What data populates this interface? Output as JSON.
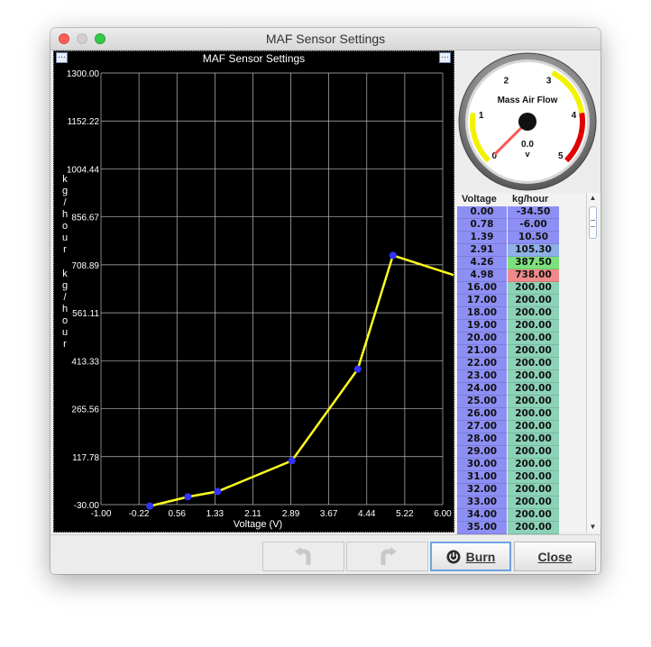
{
  "window": {
    "title": "MAF Sensor Settings"
  },
  "chart": {
    "title": "MAF Sensor Settings",
    "menu_glyph": "...",
    "xlabel": "Voltage (V)",
    "ylabel_chars": [
      "k",
      "g",
      "/",
      "h",
      "o",
      "u",
      "r"
    ],
    "y_ticks": [
      "1300.00",
      "1152.22",
      "1004.44",
      "856.67",
      "708.89",
      "561.11",
      "413.33",
      "265.56",
      "117.78",
      "-30.00"
    ],
    "x_ticks": [
      "-1.00",
      "-0.22",
      "0.56",
      "1.33",
      "2.11",
      "2.89",
      "3.67",
      "4.44",
      "5.22",
      "6.00"
    ]
  },
  "chart_data": {
    "type": "line",
    "title": "MAF Sensor Settings",
    "xlabel": "Voltage (V)",
    "ylabel": "kg/hour",
    "xlim": [
      -1.0,
      6.0
    ],
    "ylim": [
      -30.0,
      1300.0
    ],
    "grid": true,
    "x": [
      0.0,
      0.78,
      1.39,
      2.91,
      4.26,
      4.98,
      16.0
    ],
    "y": [
      -34.5,
      -6.0,
      10.5,
      105.3,
      387.5,
      738.0,
      200.0
    ],
    "line_color": "#ffff22",
    "point_color": "#3333ff"
  },
  "gauge": {
    "title": "Mass Air Flow",
    "value": "0.0",
    "units": "v",
    "labels": [
      "0",
      "1",
      "2",
      "3",
      "4",
      "5"
    ],
    "min": 0,
    "max": 5,
    "warn_low": [
      0,
      1
    ],
    "warn_high": [
      3,
      4
    ],
    "danger_high": [
      4,
      5
    ],
    "colors": {
      "warn": "#f3f300",
      "danger": "#e10000",
      "needle": "#ff5555"
    }
  },
  "table": {
    "headers": [
      "Voltage",
      "kg/hour"
    ],
    "rows": [
      [
        "0.00",
        "-34.50",
        "#8d8ff5"
      ],
      [
        "0.78",
        "-6.00",
        "#8d8ff5"
      ],
      [
        "1.39",
        "10.50",
        "#8d8ff5"
      ],
      [
        "2.91",
        "105.30",
        "#8fb0e8"
      ],
      [
        "4.26",
        "387.50",
        "#7de07d"
      ],
      [
        "4.98",
        "738.00",
        "#f08a8a"
      ],
      [
        "16.00",
        "200.00",
        "#8cd2b8"
      ],
      [
        "17.00",
        "200.00",
        "#8cd2b8"
      ],
      [
        "18.00",
        "200.00",
        "#8cd2b8"
      ],
      [
        "19.00",
        "200.00",
        "#8cd2b8"
      ],
      [
        "20.00",
        "200.00",
        "#8cd2b8"
      ],
      [
        "21.00",
        "200.00",
        "#8cd2b8"
      ],
      [
        "22.00",
        "200.00",
        "#8cd2b8"
      ],
      [
        "23.00",
        "200.00",
        "#8cd2b8"
      ],
      [
        "24.00",
        "200.00",
        "#8cd2b8"
      ],
      [
        "25.00",
        "200.00",
        "#8cd2b8"
      ],
      [
        "26.00",
        "200.00",
        "#8cd2b8"
      ],
      [
        "27.00",
        "200.00",
        "#8cd2b8"
      ],
      [
        "28.00",
        "200.00",
        "#8cd2b8"
      ],
      [
        "29.00",
        "200.00",
        "#8cd2b8"
      ],
      [
        "30.00",
        "200.00",
        "#8cd2b8"
      ],
      [
        "31.00",
        "200.00",
        "#8cd2b8"
      ],
      [
        "32.00",
        "200.00",
        "#8cd2b8"
      ],
      [
        "33.00",
        "200.00",
        "#8cd2b8"
      ],
      [
        "34.00",
        "200.00",
        "#8cd2b8"
      ],
      [
        "35.00",
        "200.00",
        "#8cd2b8"
      ]
    ]
  },
  "buttons": {
    "burn": "Burn",
    "close": "Close"
  }
}
